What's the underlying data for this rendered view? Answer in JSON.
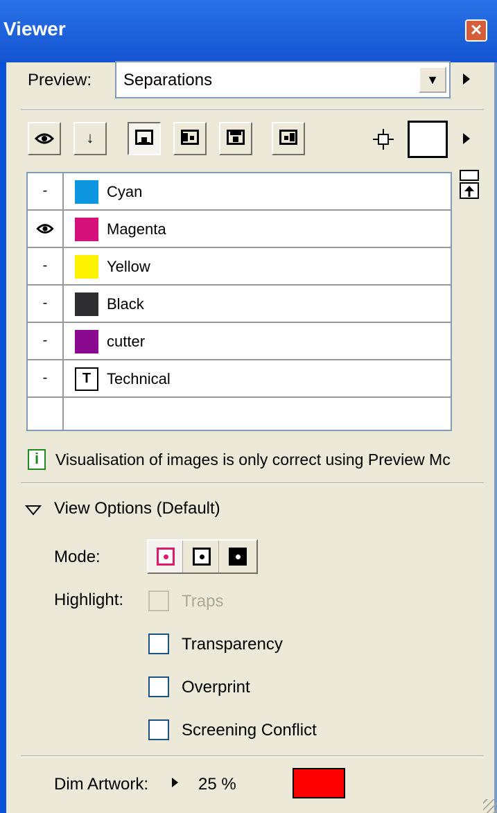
{
  "window": {
    "title": "Viewer",
    "close_icon": "close-icon"
  },
  "preview": {
    "label": "Preview:",
    "value": "Separations"
  },
  "toolbar": {
    "buttons": [
      "eye-toggle-icon",
      "down-arrow-icon",
      "view-front-icon",
      "view-right-icon",
      "view-top-icon",
      "view-left-icon"
    ]
  },
  "separations": [
    {
      "visible": "-",
      "name": "Cyan",
      "color": "#0D96E0"
    },
    {
      "visible": "eye",
      "name": "Magenta",
      "color": "#D6107A"
    },
    {
      "visible": "-",
      "name": "Yellow",
      "color": "#FFF200"
    },
    {
      "visible": "-",
      "name": "Black",
      "color": "#2E2E31"
    },
    {
      "visible": "-",
      "name": "cutter",
      "color": "#8A0990"
    },
    {
      "visible": "-",
      "name": "Technical",
      "color": "#FFFFFF",
      "icon": "T"
    }
  ],
  "info": {
    "text": "Visualisation of images is only correct using Preview Mc"
  },
  "view_options": {
    "header": "View Options (Default)",
    "mode_label": "Mode:",
    "highlight_label": "Highlight:",
    "checkboxes": [
      {
        "label": "Traps",
        "checked": false,
        "disabled": true
      },
      {
        "label": "Transparency",
        "checked": false,
        "disabled": false
      },
      {
        "label": "Overprint",
        "checked": false,
        "disabled": false
      },
      {
        "label": "Screening Conflict",
        "checked": false,
        "disabled": false
      }
    ]
  },
  "dim": {
    "label": "Dim Artwork:",
    "value": "25 %",
    "color": "#FF0000"
  }
}
